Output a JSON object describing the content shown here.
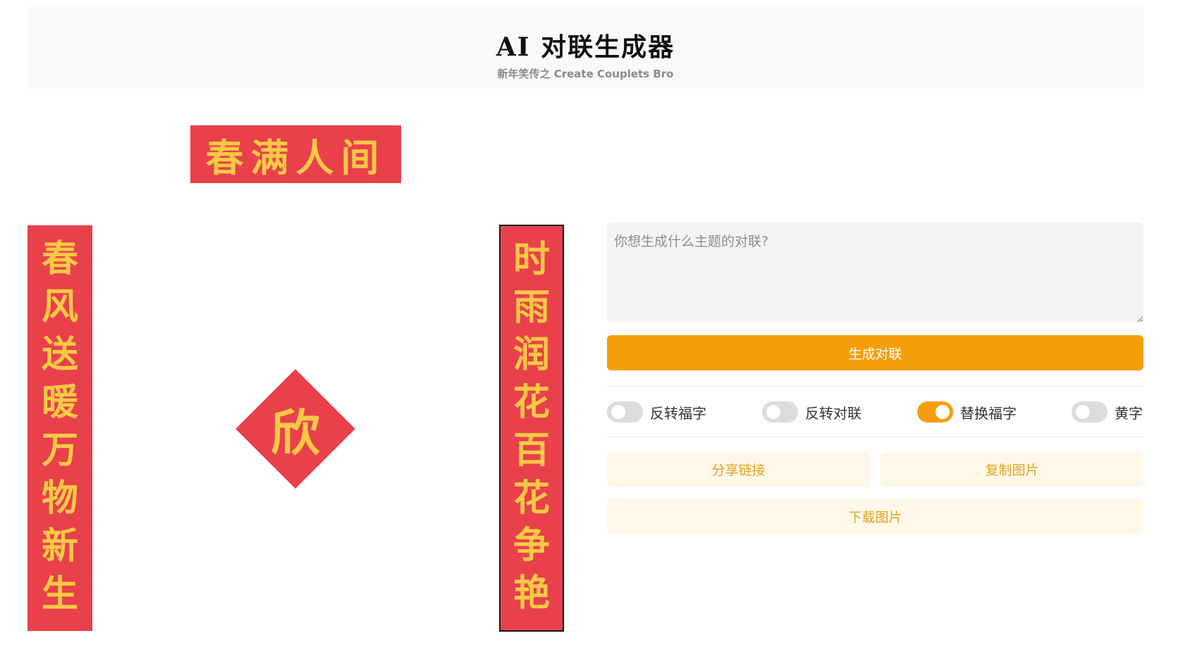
{
  "header": {
    "title": "AI 对联生成器",
    "subtitle": "新年笑传之 Create Couplets Bro"
  },
  "couplet": {
    "horizontal": "春满人间",
    "left": [
      "春",
      "风",
      "送",
      "暖",
      "万",
      "物",
      "新",
      "生"
    ],
    "right": [
      "时",
      "雨",
      "润",
      "花",
      "百",
      "花",
      "争",
      "艳"
    ],
    "fu": "欣"
  },
  "form": {
    "placeholder": "你想生成什么主题的对联?",
    "value": "",
    "generate_label": "生成对联"
  },
  "toggles": [
    {
      "label": "反转福字",
      "checked": false
    },
    {
      "label": "反转对联",
      "checked": false
    },
    {
      "label": "替换福字",
      "checked": true
    },
    {
      "label": "黄字",
      "checked": false
    }
  ],
  "actions": {
    "share_label": "分享链接",
    "copy_label": "复制图片",
    "download_label": "下载图片"
  },
  "colors": {
    "paper_red": "#e9404c",
    "gold_text": "#f7c945",
    "accent_orange": "#f59e0c",
    "soft_button_bg": "#fff8e8"
  }
}
